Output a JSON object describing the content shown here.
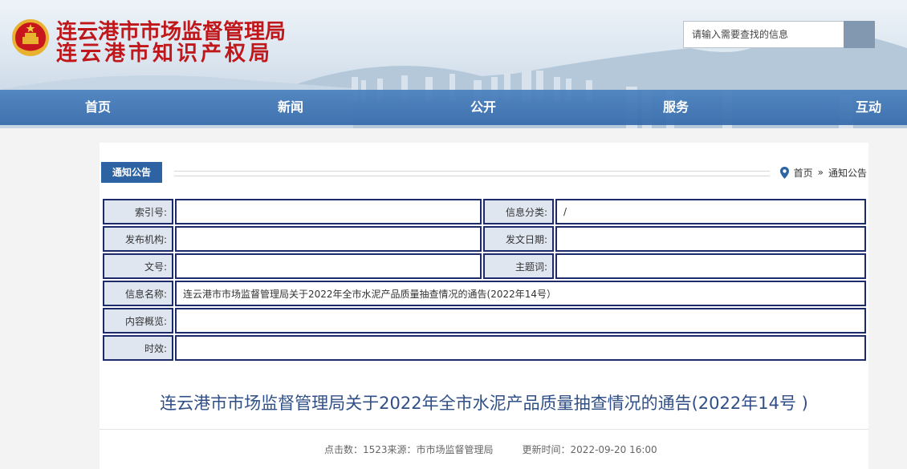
{
  "header": {
    "title_line1": "连云港市市场监督管理局",
    "title_line2": "连云港市知识产权局",
    "search": {
      "placeholder": "请输入需要查找的信息"
    }
  },
  "nav": {
    "items": [
      {
        "label": "首页"
      },
      {
        "label": "新闻"
      },
      {
        "label": "公开"
      },
      {
        "label": "服务"
      },
      {
        "label": "互动"
      }
    ]
  },
  "section": {
    "tab_label": "通知公告"
  },
  "breadcrumb": {
    "home": "首页",
    "separator": "»",
    "current": "通知公告"
  },
  "info_table": {
    "index_label": "索引号:",
    "index_value": "",
    "category_label": "信息分类:",
    "category_value": "/",
    "publisher_label": "发布机构:",
    "publisher_value": "",
    "date_label": "发文日期:",
    "date_value": "",
    "doc_no_label": "文号:",
    "doc_no_value": "",
    "subject_label": "主题词:",
    "subject_value": "",
    "name_label": "信息名称:",
    "name_value": "连云港市市场监督管理局关于2022年全市水泥产品质量抽查情况的通告(2022年14号）",
    "summary_label": "内容概览:",
    "summary_value": "",
    "validity_label": "时效:",
    "validity_value": ""
  },
  "article": {
    "title": "连云港市市场监督管理局关于2022年全市水泥产品质量抽查情况的通告(2022年14号 )",
    "meta": "点击数：1523来源：市市场监督管理局　　　更新时间：2022-09-20 16:00"
  },
  "colors": {
    "title_red": "#c0171b",
    "nav_blue": "#3f77b8",
    "tab_blue": "#2d63a3",
    "table_border": "#1e2b6a",
    "label_bg": "#dfe6f0",
    "article_title": "#2f4f86"
  }
}
